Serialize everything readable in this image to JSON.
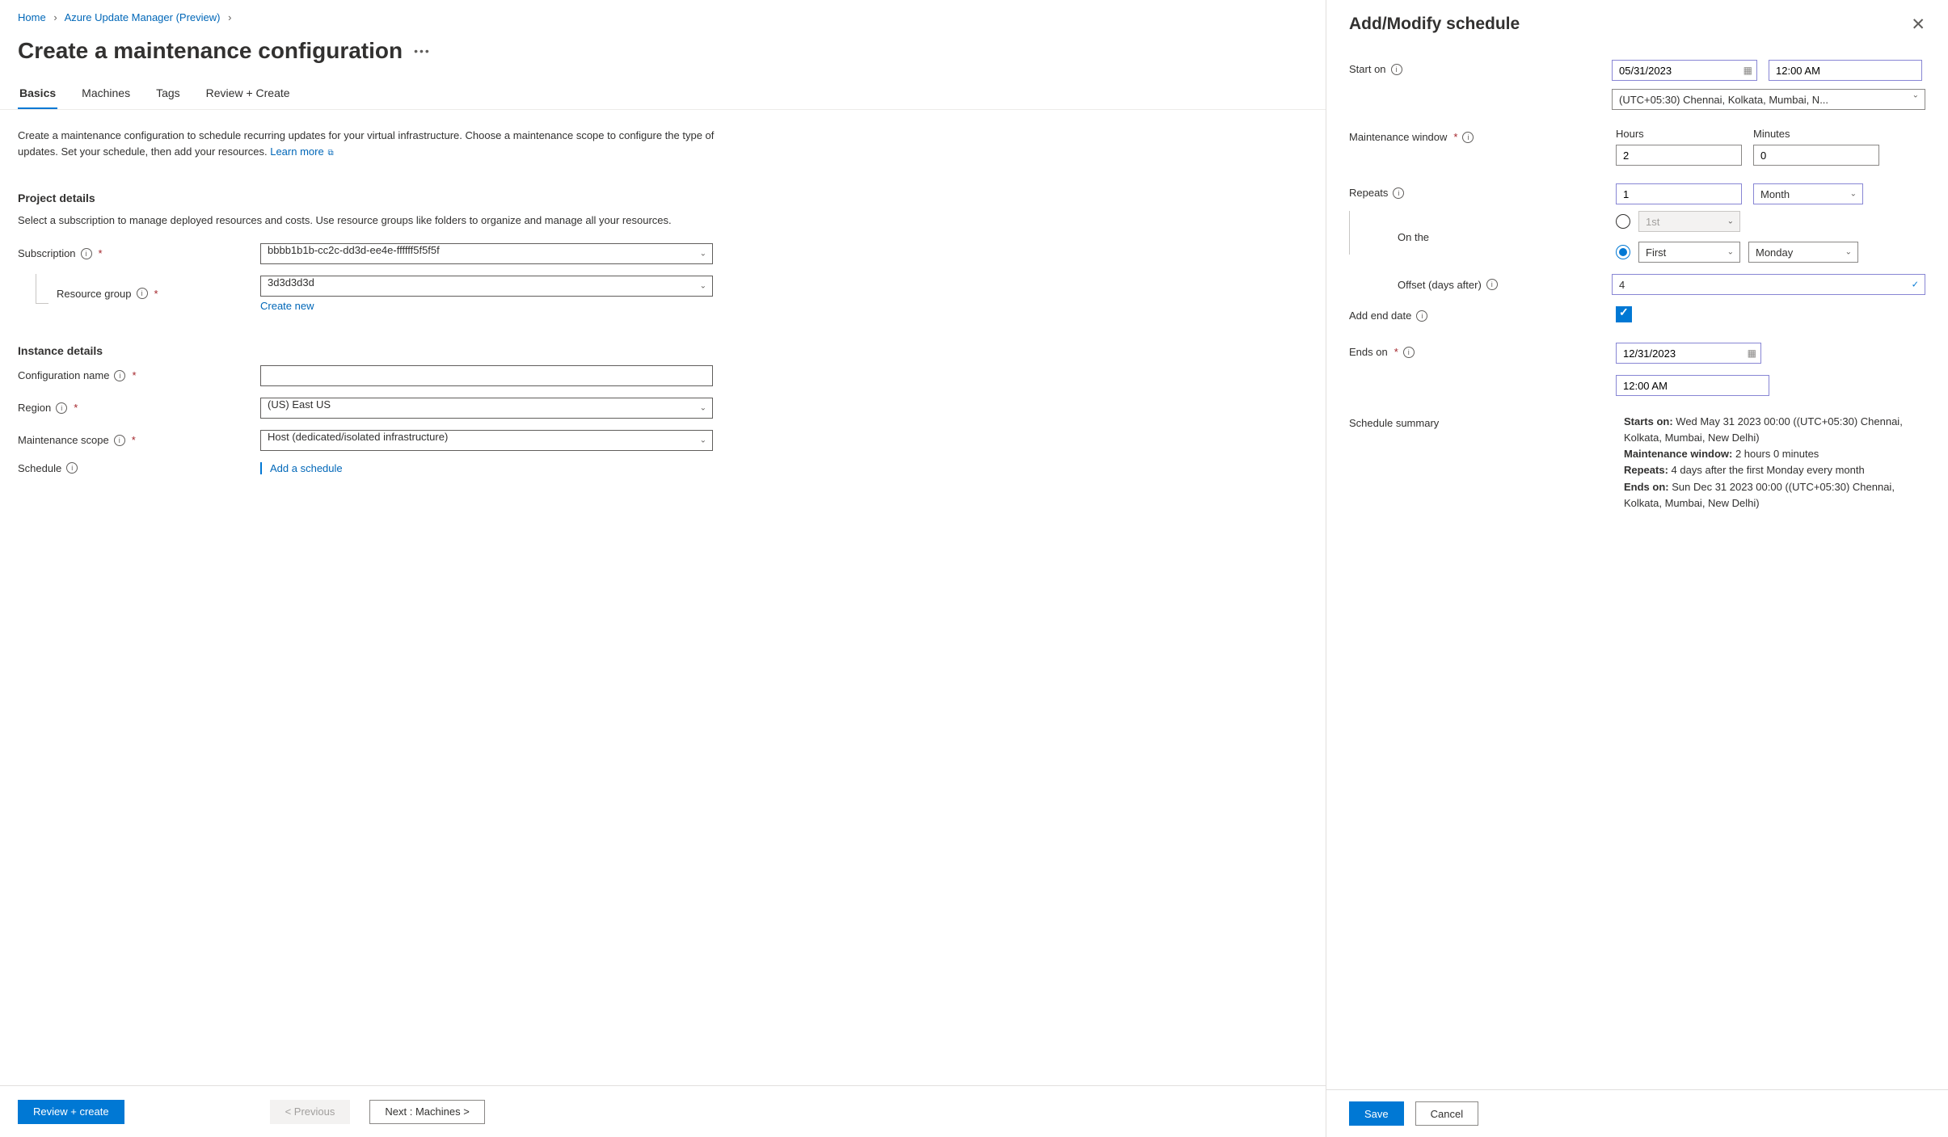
{
  "breadcrumb": {
    "home": "Home",
    "item2": "Azure Update Manager (Preview)"
  },
  "page_title": "Create a maintenance configuration",
  "tabs": {
    "basics": "Basics",
    "machines": "Machines",
    "tags": "Tags",
    "review": "Review + Create"
  },
  "desc": {
    "text": "Create a maintenance configuration to schedule recurring updates for your virtual infrastructure. Choose a maintenance scope to configure the type of updates. Set your schedule, then add your resources.",
    "learn_more": "Learn more"
  },
  "project": {
    "heading": "Project details",
    "desc": "Select a subscription to manage deployed resources and costs. Use resource groups like folders to organize and manage all your resources.",
    "subscription_label": "Subscription",
    "subscription_value": "bbbb1b1b-cc2c-dd3d-ee4e-ffffff5f5f5f",
    "rg_label": "Resource group",
    "rg_value": "3d3d3d3d",
    "create_new": "Create new"
  },
  "instance": {
    "heading": "Instance details",
    "config_name_label": "Configuration name",
    "config_name_value": "",
    "region_label": "Region",
    "region_value": "(US) East US",
    "scope_label": "Maintenance scope",
    "scope_value": "Host (dedicated/isolated infrastructure)",
    "schedule_label": "Schedule",
    "add_schedule": "Add a schedule"
  },
  "footer": {
    "review_create": "Review + create",
    "previous": "< Previous",
    "next": "Next : Machines >"
  },
  "panel": {
    "title": "Add/Modify schedule",
    "start_on_label": "Start on",
    "start_date": "05/31/2023",
    "start_time": "12:00 AM",
    "timezone": "(UTC+05:30) Chennai, Kolkata, Mumbai, N...",
    "mw_label": "Maintenance window",
    "hours_label": "Hours",
    "hours_value": "2",
    "minutes_label": "Minutes",
    "minutes_value": "0",
    "repeats_label": "Repeats",
    "repeats_num": "1",
    "repeats_unit": "Month",
    "on_the_label": "On the",
    "day_num_disabled": "1st",
    "ordinal": "First",
    "weekday": "Monday",
    "offset_label": "Offset (days after)",
    "offset_value": "4",
    "add_end_label": "Add end date",
    "ends_on_label": "Ends on",
    "ends_date": "12/31/2023",
    "ends_time": "12:00 AM",
    "summary_label": "Schedule summary",
    "summary": {
      "starts_label": "Starts on:",
      "starts_val": "Wed May 31 2023 00:00 ((UTC+05:30) Chennai, Kolkata, Mumbai, New Delhi)",
      "mw_label": "Maintenance window:",
      "mw_val": "2 hours 0 minutes",
      "repeats_label": "Repeats:",
      "repeats_val": "4 days after the first Monday every month",
      "ends_label": "Ends on:",
      "ends_val": "Sun Dec 31 2023 00:00 ((UTC+05:30) Chennai, Kolkata, Mumbai, New Delhi)"
    },
    "save": "Save",
    "cancel": "Cancel"
  }
}
